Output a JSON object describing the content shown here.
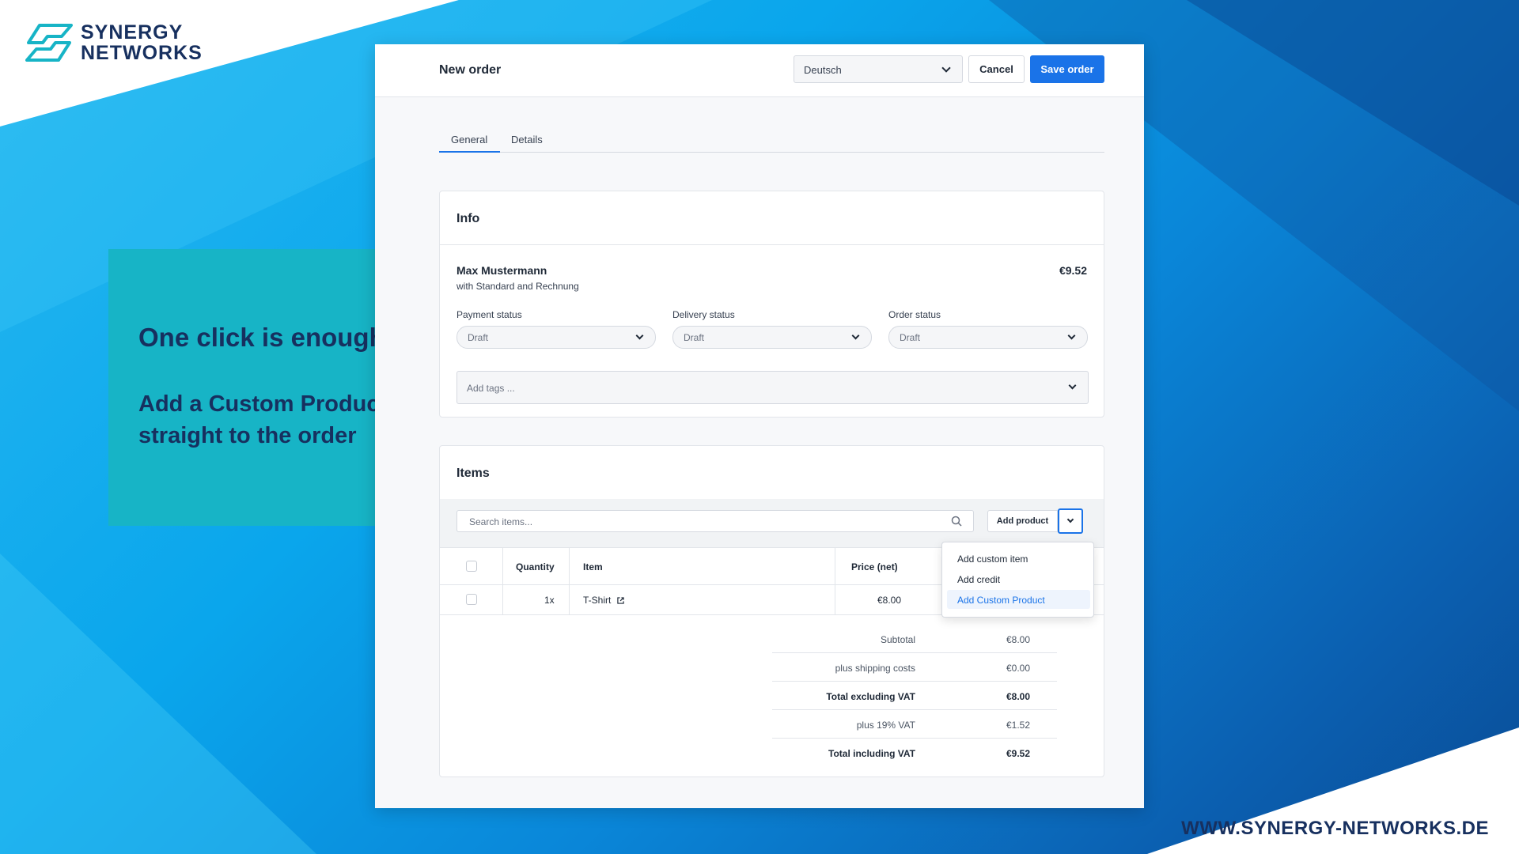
{
  "brand": {
    "line1": "SYNERGY",
    "line2": "NETWORKS",
    "website": "WWW.SYNERGY-NETWORKS.DE"
  },
  "callout": {
    "heading": "One click is enough",
    "subheading": "Add a Custom Product straight to the order"
  },
  "header": {
    "title": "New order",
    "language": "Deutsch",
    "cancel_label": "Cancel",
    "save_label": "Save order"
  },
  "tabs": [
    {
      "label": "General",
      "active": true
    },
    {
      "label": "Details",
      "active": false
    }
  ],
  "info": {
    "title": "Info",
    "customer_name": "Max Mustermann",
    "customer_sub": "with Standard and Rechnung",
    "total": "€9.52",
    "payment_status": {
      "label": "Payment status",
      "value": "Draft"
    },
    "delivery_status": {
      "label": "Delivery status",
      "value": "Draft"
    },
    "order_status": {
      "label": "Order status",
      "value": "Draft"
    },
    "tags_placeholder": "Add tags ..."
  },
  "items": {
    "title": "Items",
    "search_placeholder": "Search items...",
    "add_product_label": "Add product",
    "columns": {
      "quantity": "Quantity",
      "item": "Item",
      "price": "Price (net)"
    },
    "rows": [
      {
        "quantity": "1x",
        "item": "T-Shirt",
        "price": "€8.00"
      }
    ],
    "totals": [
      {
        "label": "Subtotal",
        "value": "€8.00",
        "bold": false
      },
      {
        "label": "plus shipping costs",
        "value": "€0.00",
        "bold": false
      },
      {
        "label": "Total excluding VAT",
        "value": "€8.00",
        "bold": true
      },
      {
        "label": "plus 19% VAT",
        "value": "€1.52",
        "bold": false
      },
      {
        "label": "Total including VAT",
        "value": "€9.52",
        "bold": true
      }
    ]
  },
  "dropdown": {
    "items": [
      {
        "label": "Add custom item",
        "active": false
      },
      {
        "label": "Add credit",
        "active": false
      },
      {
        "label": "Add Custom Product",
        "active": true
      }
    ]
  },
  "colors": {
    "accent": "#1a73e8",
    "brand_navy": "#17305f",
    "callout_teal": "#17b4c6"
  }
}
